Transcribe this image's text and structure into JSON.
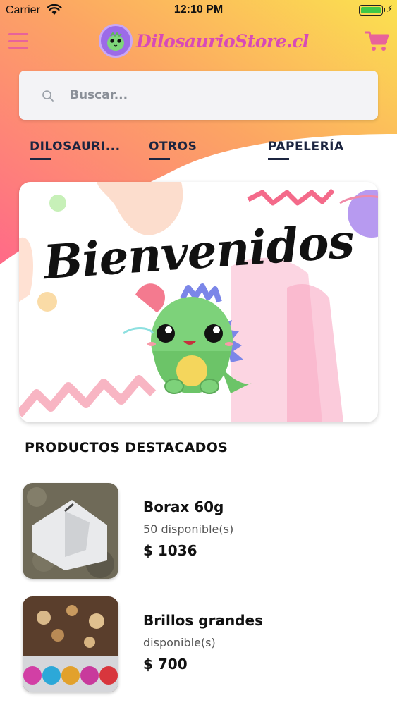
{
  "status_bar": {
    "carrier": "Carrier",
    "time": "12:10 PM",
    "wifi_icon": "wifi-icon",
    "battery_icon": "battery-icon",
    "battery_level": 1.0
  },
  "header": {
    "menu_icon": "hamburger-menu-icon",
    "brand_name": "DilosaurioStore.cl",
    "cart_icon": "shopping-cart-icon",
    "accent_color": "#e8639a"
  },
  "search": {
    "placeholder": "Buscar...",
    "value": "",
    "icon": "search-icon"
  },
  "tabs": [
    {
      "label": "DILOSAURI..."
    },
    {
      "label": "OTROS"
    },
    {
      "label": "PAPELERÍA"
    }
  ],
  "banner": {
    "title": "Bienvenidos"
  },
  "featured": {
    "title": "PRODUCTOS DESTACADOS",
    "products": [
      {
        "name": "Borax 60g",
        "stock": "50 disponible(s)",
        "price": "$ 1036"
      },
      {
        "name": "Brillos grandes",
        "stock": "disponible(s)",
        "price": "$ 700"
      }
    ]
  },
  "colors": {
    "gradient_top": "#fbd04f",
    "gradient_bottom": "#ff6a88",
    "tab_text": "#1c2540",
    "brand_pink": "#d84ab7",
    "battery_green": "#3fc846"
  }
}
